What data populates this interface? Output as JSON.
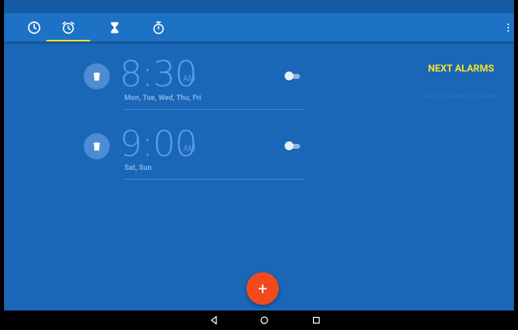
{
  "tabs": [
    {
      "icon": "clock-icon",
      "label": "Clock",
      "selected": false
    },
    {
      "icon": "alarm-icon",
      "label": "Alarm",
      "selected": true
    },
    {
      "icon": "hourglass-icon",
      "label": "Timer",
      "selected": false
    },
    {
      "icon": "stopwatch-icon",
      "label": "Stopwatch",
      "selected": false
    }
  ],
  "alarms": [
    {
      "time": "8:30",
      "ampm": "AM",
      "days": "Mon, Tue, Wed, Thu, Fri",
      "enabled": false
    },
    {
      "time": "9:00",
      "ampm": "AM",
      "days": "Sat, Sun",
      "enabled": false
    }
  ],
  "next_alarms": {
    "title": "NEXT ALARMS",
    "empty_text": "NO UPCOMING ALARMS"
  },
  "fab": {
    "label": "+",
    "icon": "add-icon"
  },
  "colors": {
    "background": "#1a67b8",
    "tab_bar": "#1d72c5",
    "accent": "#f5e12b",
    "fab": "#f14a1c"
  },
  "nav": {
    "icons": [
      "back-icon",
      "home-icon",
      "recents-icon"
    ]
  }
}
